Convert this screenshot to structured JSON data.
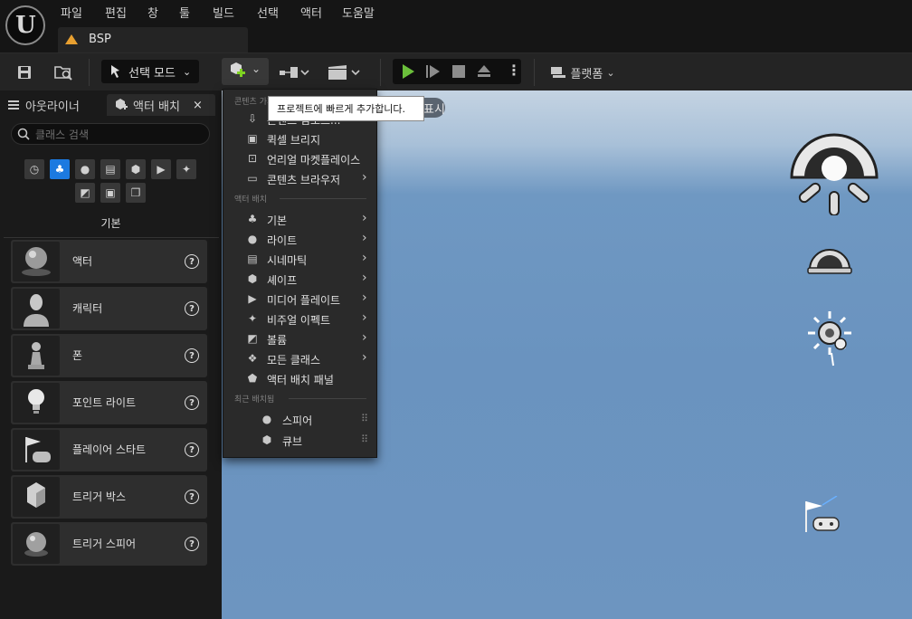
{
  "menubar": {
    "items": [
      "파일",
      "편집",
      "창",
      "툴",
      "빌드",
      "선택",
      "액터",
      "도움말"
    ]
  },
  "doc_tab": {
    "label": "BSP"
  },
  "toolbar": {
    "mode_label": "선택 모드",
    "platforms_label": "플랫폼"
  },
  "left_panel": {
    "tabs": {
      "outliner": "아웃라이너",
      "place_actors": "액터 배치",
      "close": "×"
    },
    "search_placeholder": "클래스 검색",
    "category_title": "기본",
    "items": [
      {
        "label": "액터"
      },
      {
        "label": "캐릭터"
      },
      {
        "label": "폰"
      },
      {
        "label": "포인트 라이트"
      },
      {
        "label": "플레이어 스타트"
      },
      {
        "label": "트리거 박스"
      },
      {
        "label": "트리거 스피어"
      }
    ]
  },
  "dropdown": {
    "section_content": "콘텐츠 가져오기",
    "content_items": [
      {
        "label": "콘텐츠 임포트..."
      },
      {
        "label": "퀵셀 브리지"
      },
      {
        "label": "언리얼 마켓플레이스"
      },
      {
        "label": "콘텐츠 브라우저"
      }
    ],
    "section_actors": "액터 배치",
    "actor_items": [
      {
        "label": "기본"
      },
      {
        "label": "라이트"
      },
      {
        "label": "시네마틱"
      },
      {
        "label": "셰이프"
      },
      {
        "label": "미디어 플레이트"
      },
      {
        "label": "비주얼 이펙트"
      },
      {
        "label": "볼륨"
      },
      {
        "label": "모든 클래스"
      },
      {
        "label": "액터 배치 패널"
      }
    ],
    "section_recent": "최근 배치됨",
    "recent_items": [
      {
        "label": "스피어"
      },
      {
        "label": "큐브"
      }
    ]
  },
  "tooltip": {
    "text": "프로젝트에 빠르게 추가합니다."
  },
  "viewport": {
    "pill_text": "표시"
  },
  "colors": {
    "accent": "#1c7ae0",
    "play_green": "#6bbf3b",
    "add_green": "#7ed321"
  }
}
